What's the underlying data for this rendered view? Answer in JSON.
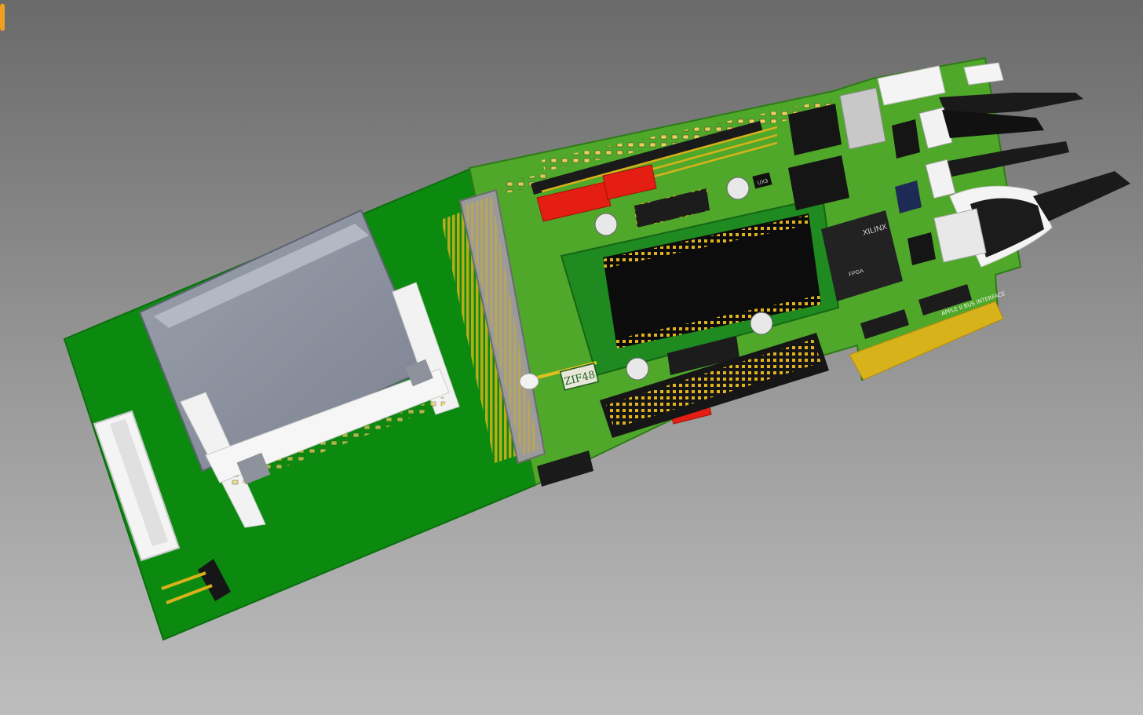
{
  "viewport": {
    "background_top": "#6b6b6b",
    "background_bottom": "#bcbcbc",
    "corner_icon": "orange-tab-icon"
  },
  "board": {
    "adapter_pcb_color": "#0c8a10",
    "main_pcb_color": "#4fa82a",
    "gold_color": "#d8b21a",
    "jumper_color": "#e41e12",
    "labels": {
      "zif": "ZIF48",
      "fpga_brand": "XILINX",
      "fpga_type": "FPGA",
      "edge_caption": "APPLE II BUS INTERFACE",
      "reg_label": "UX3"
    }
  }
}
